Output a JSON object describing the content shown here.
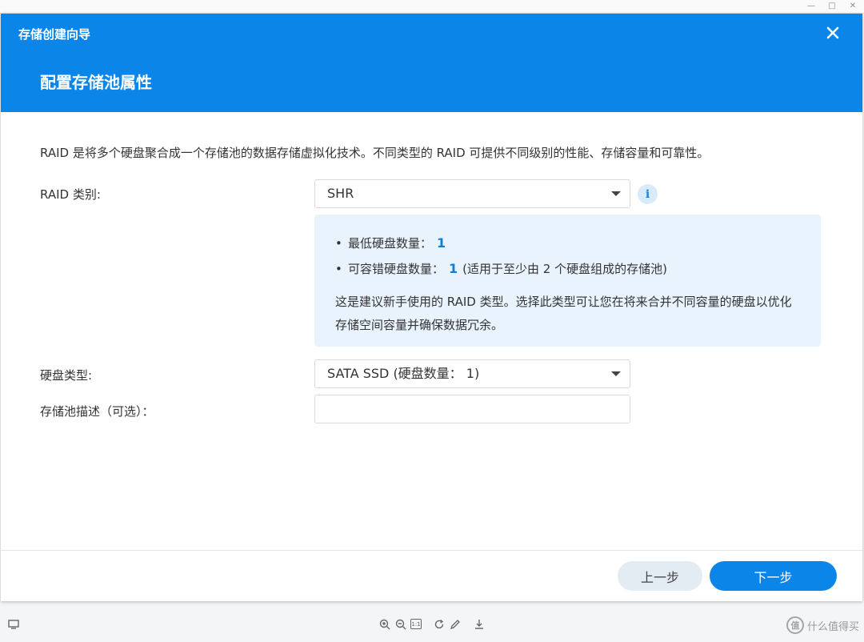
{
  "dialog": {
    "wizard_title": "存储创建向导",
    "step_title": "配置存储池属性",
    "intro": "RAID 是将多个硬盘聚合成一个存储池的数据存储虚拟化技术。不同类型的 RAID 可提供不同级别的性能、存储容量和可靠性。"
  },
  "form": {
    "raid_type": {
      "label": "RAID 类别:",
      "value": "SHR"
    },
    "disk_type": {
      "label": "硬盘类型:",
      "value": "SATA SSD (硬盘数量： 1)"
    },
    "pool_desc": {
      "label": "存储池描述（可选）：",
      "value": ""
    }
  },
  "info": {
    "min_disks": {
      "label": "最低硬盘数量：",
      "value": "1"
    },
    "fault_tolerance": {
      "label": "可容错硬盘数量：",
      "value": "1",
      "note": "(适用于至少由 2 个硬盘组成的存储池)"
    },
    "description": "这是建议新手使用的 RAID 类型。选择此类型可让您在将来合并不同容量的硬盘以优化存储空间容量并确保数据冗余。"
  },
  "buttons": {
    "prev": "上一步",
    "next": "下一步"
  },
  "toolbar": {
    "zoom_fit_label": "1:1"
  },
  "watermark": {
    "text": "什么值得买",
    "logo_text": "值"
  },
  "colors": {
    "accent": "#0b86e8",
    "info_bg": "#e8f3fd",
    "highlight": "#0b7fd8"
  }
}
